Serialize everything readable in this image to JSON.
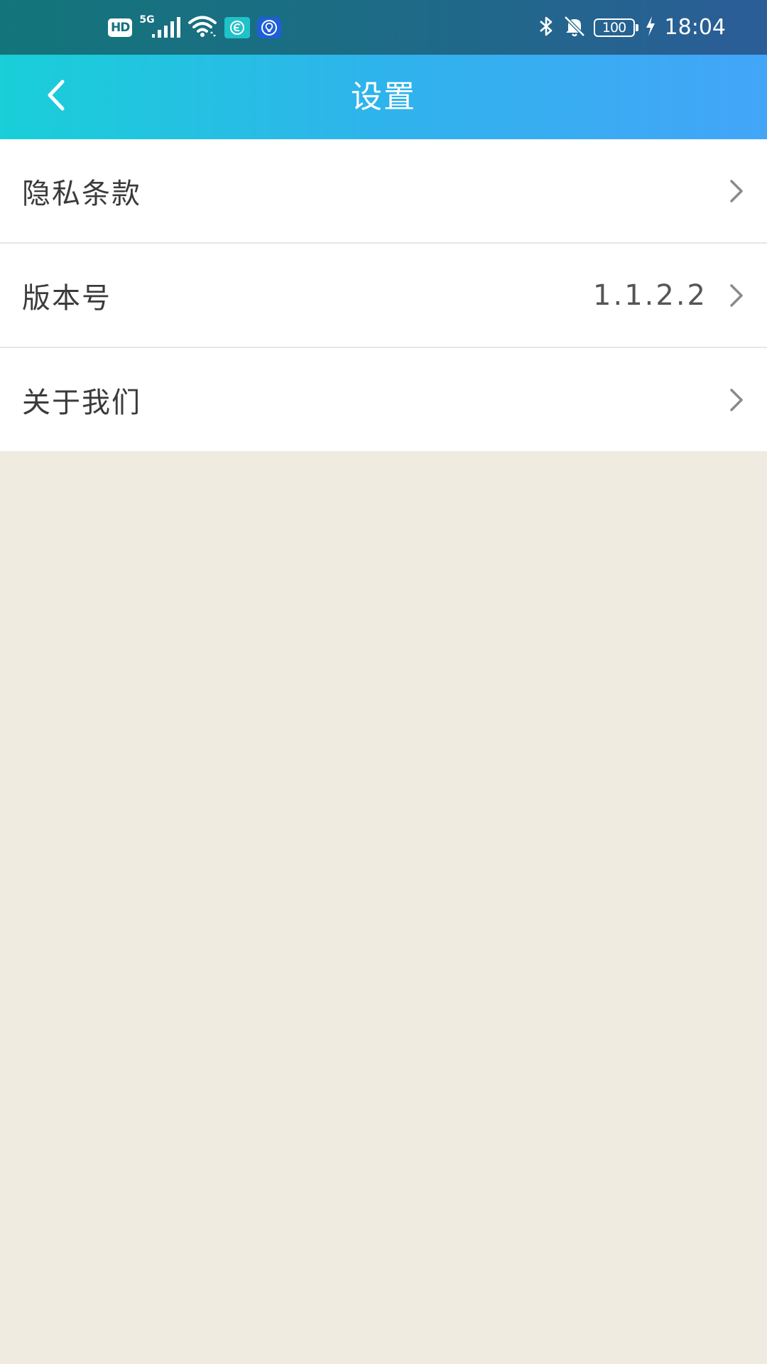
{
  "status_bar": {
    "hd_label": "HD",
    "network_label": "5G",
    "battery_level": "100",
    "time": "18:04",
    "left_icons": [
      "hd-icon",
      "signal-5g-icon",
      "wifi-icon",
      "app-e-icon",
      "app-bulb-icon"
    ],
    "right_icons": [
      "bluetooth-icon",
      "bell-muted-icon",
      "battery-icon",
      "charging-icon"
    ]
  },
  "header": {
    "title": "设置",
    "back_icon": "chevron-left-icon",
    "gradient": [
      "#19cfd8",
      "#43a5f8"
    ]
  },
  "settings": {
    "items": [
      {
        "label": "隐私条款",
        "value": ""
      },
      {
        "label": "版本号",
        "value": "1.1.2.2"
      },
      {
        "label": "关于我们",
        "value": ""
      }
    ]
  },
  "colors": {
    "page_background": "#efebe0",
    "list_background": "#ffffff",
    "text": "#3b3b3b",
    "chevron": "#8a8a8a"
  }
}
